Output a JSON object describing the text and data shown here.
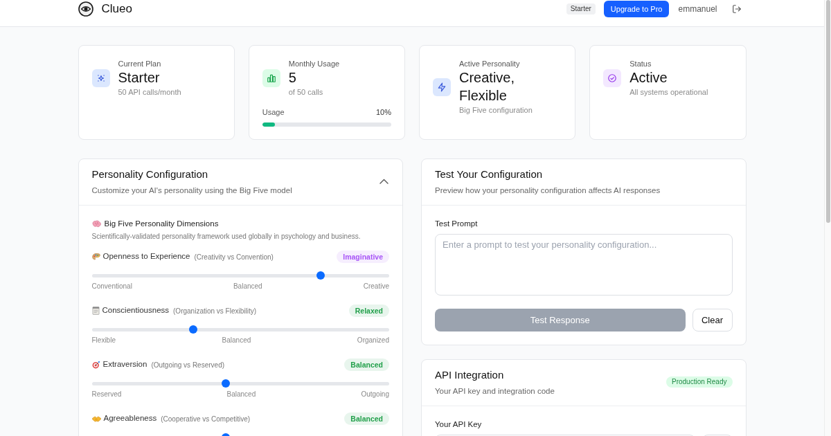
{
  "header": {
    "brand": "Clueo",
    "plan_badge": "Starter",
    "upgrade_button": "Upgrade to Pro",
    "username": "emmanuel"
  },
  "stats": [
    {
      "kind": "plan",
      "label": "Current Plan",
      "value": "Starter",
      "detail": "50 API calls/month"
    },
    {
      "kind": "usage",
      "label": "Monthly Usage",
      "value": "5",
      "detail": "of 50 calls",
      "meter": {
        "label": "Usage",
        "reading": "10%",
        "level": 0.1
      }
    },
    {
      "kind": "personality",
      "label": "Active Personality",
      "value": "Creative, Flexible",
      "detail": "Big Five configuration"
    },
    {
      "kind": "status",
      "label": "Status",
      "value": "Active",
      "detail": "All systems operational"
    }
  ],
  "personality_panel": {
    "title": "Personality Configuration",
    "subtitle": "Customize your AI's personality using the Big Five model",
    "expanded": true,
    "section_title": "Big Five Personality Dimensions",
    "section_description": "Scientifically-validated personality framework used globally in psychology and business.",
    "traits": [
      {
        "name": "Openness to Experience",
        "axis": "(Creativity vs Convention)",
        "badge": {
          "text": "Imaginative",
          "color": "#a855f7"
        },
        "level": 0.77,
        "scale": [
          "Conventional",
          "Balanced",
          "Creative"
        ]
      },
      {
        "name": "Conscientiousness",
        "axis": "(Organization vs Flexibility)",
        "badge": {
          "text": "Relaxed",
          "color": "#22a04b"
        },
        "level": 0.34,
        "scale": [
          "Flexible",
          "Balanced",
          "Organized"
        ]
      },
      {
        "name": "Extraversion",
        "axis": "(Outgoing vs Reserved)",
        "badge": {
          "text": "Balanced",
          "color": "#22a04b"
        },
        "level": 0.45,
        "scale": [
          "Reserved",
          "Balanced",
          "Outgoing"
        ]
      },
      {
        "name": "Agreeableness",
        "axis": "(Cooperative vs Competitive)",
        "badge": {
          "text": "Balanced",
          "color": "#22a04b"
        },
        "level": 0.45
      }
    ]
  },
  "test_panel": {
    "title": "Test Your Configuration",
    "subtitle": "Preview how your personality configuration affects AI responses",
    "prompt_label": "Test Prompt",
    "prompt_placeholder": "Enter a prompt to test your personality configuration...",
    "submit_button": {
      "label": "Test Response",
      "disabled": true
    },
    "clear_button": "Clear"
  },
  "api_panel": {
    "title": "API Integration",
    "subtitle": "Your API key and integration code",
    "badge": "Production Ready",
    "key_label": "Your API Key"
  }
}
